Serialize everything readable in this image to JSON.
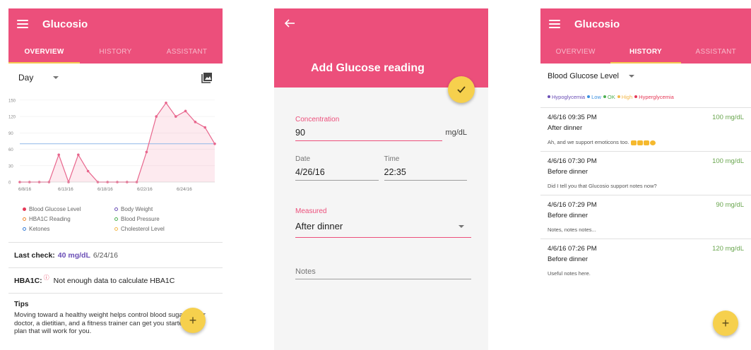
{
  "colors": {
    "primary": "#ec4f7b",
    "accent": "#f6d04d",
    "purple": "#6b4fb6",
    "green": "#6aa64f"
  },
  "app_title": "Glucosio",
  "tabs": [
    "OVERVIEW",
    "HISTORY",
    "ASSISTANT"
  ],
  "overview": {
    "range": "Day",
    "chart_data": {
      "type": "line",
      "x_tick_labels": [
        "6/8/16",
        "6/13/16",
        "6/18/16",
        "6/22/16",
        "6/24/16"
      ],
      "y_ticks": [
        0,
        30,
        60,
        90,
        120,
        150
      ],
      "ylim": [
        0,
        155
      ],
      "reference_line": 70,
      "series": [
        {
          "values": [
            0,
            0,
            0,
            0,
            50,
            0,
            50,
            20,
            0,
            0,
            0,
            0,
            0,
            55,
            120,
            145,
            120,
            130,
            110,
            100,
            70
          ]
        }
      ]
    },
    "legend": [
      {
        "label": "Blood Glucose Level",
        "color": "#e53957",
        "style": "filled"
      },
      {
        "label": "Body Weight",
        "color": "#6b4fb6",
        "style": "ring"
      },
      {
        "label": "HBA1C Reading",
        "color": "#ef8a2f",
        "style": "ring"
      },
      {
        "label": "Blood Pressure",
        "color": "#4caf50",
        "style": "ring"
      },
      {
        "label": "Ketones",
        "color": "#3a7fd6",
        "style": "ring"
      },
      {
        "label": "Cholesterol Level",
        "color": "#f4b84a",
        "style": "ring"
      }
    ],
    "last_check_label": "Last check:",
    "last_check_value": "40 mg/dL",
    "last_check_date": "6/24/16",
    "hba1c_label": "HBA1C:",
    "hba1c_message": "Not enough data to calculate HBA1C",
    "tips_title": "Tips",
    "tips_text": "Moving toward a healthy weight helps control blood sugars. Your doctor, a dietitian, and a fitness trainer can get you started on a plan that will work for you.",
    "fab_icon": "+"
  },
  "add_reading": {
    "title": "Add Glucose reading",
    "concentration_label": "Concentration",
    "concentration_value": "90",
    "unit": "mg/dL",
    "date_label": "Date",
    "date_value": "4/26/16",
    "time_label": "Time",
    "time_value": "22:35",
    "measured_label": "Measured",
    "measured_value": "After dinner",
    "notes_placeholder": "Notes"
  },
  "history": {
    "select_label": "Blood Glucose Level",
    "legend": [
      {
        "label": "Hypoglycemia",
        "color": "#6b4fb6"
      },
      {
        "label": "Low",
        "color": "#3a8fe0"
      },
      {
        "label": "OK",
        "color": "#4caf50"
      },
      {
        "label": "High",
        "color": "#f4b84a"
      },
      {
        "label": "Hyperglycemia",
        "color": "#e53957"
      }
    ],
    "entries": [
      {
        "datetime": "4/6/16 09:35 PM",
        "value": "100 mg/dL",
        "meal": "After dinner",
        "note": "Ah, and we support emoticons too."
      },
      {
        "datetime": "4/6/16 07:30 PM",
        "value": "100 mg/dL",
        "meal": "Before dinner",
        "note": "Did I tell you that Glucosio support notes now?"
      },
      {
        "datetime": "4/6/16 07:29 PM",
        "value": "90 mg/dL",
        "meal": "Before dinner",
        "note": "Notes, notes notes..."
      },
      {
        "datetime": "4/6/16 07:26 PM",
        "value": "120 mg/dL",
        "meal": "Before dinner",
        "note": "Useful notes here."
      }
    ],
    "fab_icon": "+"
  }
}
